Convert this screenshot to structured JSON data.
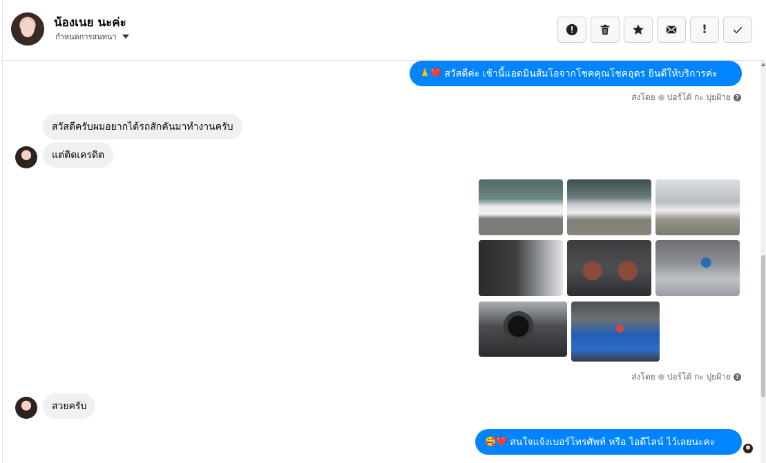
{
  "header": {
    "contact_name": "น้องเนย นะค่ะ",
    "conversation_settings": "กำหนดการสนทนา",
    "actions": [
      {
        "icon": "alert-circle-icon",
        "label": ""
      },
      {
        "icon": "trash-icon",
        "label": ""
      },
      {
        "icon": "star-icon",
        "label": ""
      },
      {
        "icon": "envelope-icon",
        "label": ""
      },
      {
        "icon": "exclamation-icon",
        "label": "!"
      },
      {
        "icon": "checkmark-icon",
        "label": ""
      }
    ]
  },
  "messages": {
    "m1": {
      "emoji": "🙏❤️",
      "text": "สวัสดีค่ะ เช้านี้แอดมินส้มโอจากโชคคุณโชคอุดร ยินดีให้บริการค่ะ",
      "sender_prefix": "ส่งโดย",
      "sender_name": "ปอร์โต้ กะ ปุยฝ้าย"
    },
    "m2": {
      "text": "สวัสดีครับผมอยากได้รถสักคันมาทำงานครับ"
    },
    "m3": {
      "text": "แต่ติดเครดิต"
    },
    "photos": {
      "sender_prefix": "ส่งโดย",
      "sender_name": "ปอร์โต้ กะ ปุยฝ้าย",
      "count": 8
    },
    "m4": {
      "text": "สวยครับ"
    },
    "m5": {
      "emoji": "🥰❤️",
      "text": "สนใจแจ้งเบอร์โทรศัพท์ หรือ ไอดีไลน์  ไว้เลยนะคะ"
    }
  },
  "colors": {
    "outgoing_bubble": "#0084ff",
    "incoming_bubble": "#f0f0f0",
    "meta_text": "#65676b"
  }
}
